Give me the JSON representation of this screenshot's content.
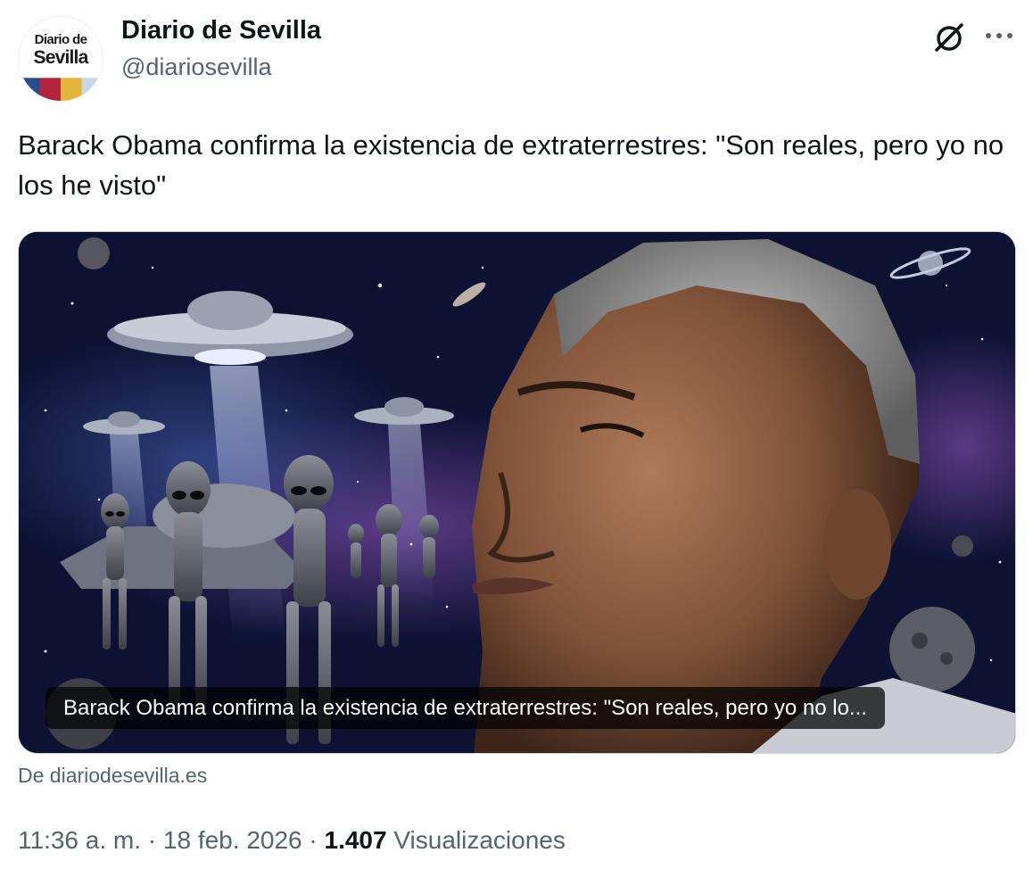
{
  "account": {
    "avatar_line1": "Diario de",
    "avatar_line2": "Sevilla",
    "avatar_colors": [
      "#2a4c8f",
      "#b3243b",
      "#e2b43a",
      "#c9d6e8"
    ],
    "display_name": "Diario de Sevilla",
    "handle": "@diariosevilla"
  },
  "header_icons": {
    "grok": "grok-icon",
    "more": "more-options-icon"
  },
  "tweet": {
    "text": "Barack Obama confirma la existencia de extraterrestres: \"Son reales, pero yo no los he visto\""
  },
  "card": {
    "caption": "Barack Obama confirma la existencia de extraterrestres: \"Son reales, pero yo no lo...",
    "image_subject": "man-face-with-aliens-and-ufos-in-space",
    "source": "De diariodesevilla.es"
  },
  "meta": {
    "time": "11:36 a. m.",
    "separator": "·",
    "date": "18 feb. 2026",
    "views_count": "1.407",
    "views_label": "Visualizaciones"
  },
  "colors": {
    "text_primary": "#0f1419",
    "text_secondary": "#536471",
    "border": "#cfd9de",
    "space_bg": "#0b0f2a"
  }
}
